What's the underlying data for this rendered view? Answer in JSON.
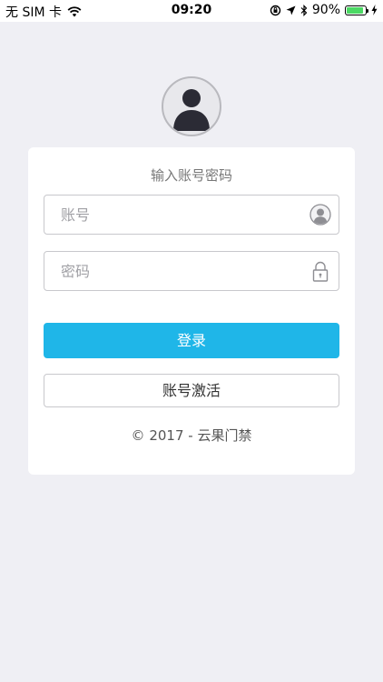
{
  "status_bar": {
    "carrier": "无 SIM 卡",
    "time": "09:20",
    "battery": "90%",
    "battery_level": 0.9,
    "icons": [
      "wifi-icon",
      "orientation-lock-icon",
      "location-arrow-icon",
      "bluetooth-icon",
      "battery-icon",
      "charging-bolt-icon"
    ],
    "battery_color": "#4cd964"
  },
  "login": {
    "avatar_icon": "user-avatar-icon",
    "title": "输入账号密码",
    "account_placeholder": "账号",
    "account_value": "",
    "account_icon": "user-circle-icon",
    "password_placeholder": "密码",
    "password_value": "",
    "password_icon": "padlock-icon",
    "login_button": "登录",
    "activate_button": "账号激活",
    "footer": "© 2017 - 云果门禁"
  },
  "colors": {
    "background": "#efeff4",
    "primary": "#1fb6e8",
    "card": "#ffffff",
    "border": "#c8c8cc"
  }
}
